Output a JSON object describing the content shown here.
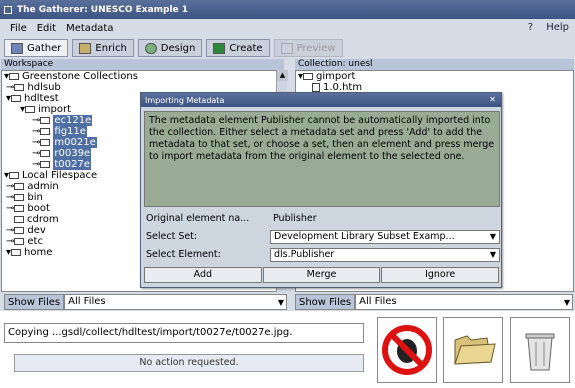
{
  "window": {
    "title": "The Gatherer: UNESCO Example 1"
  },
  "menu": {
    "file": "File",
    "edit": "Edit",
    "metadata": "Metadata",
    "help": "Help"
  },
  "tabs": [
    {
      "label": "Gather"
    },
    {
      "label": "Enrich"
    },
    {
      "label": "Design"
    },
    {
      "label": "Create"
    },
    {
      "label": "Preview"
    }
  ],
  "workspace": {
    "header": "Workspace",
    "items": [
      "Greenstone Collections",
      "hdlsub",
      "hdltest",
      "import",
      "ec121e",
      "fig11e",
      "m0021e",
      "r0039e",
      "t0027e",
      "Local Filespace",
      "admin",
      "bin",
      "boot",
      "cdrom",
      "dev",
      "etc",
      "home"
    ]
  },
  "collection": {
    "header": "Collection: unesl",
    "items": [
      "gimport",
      "1.0.htm"
    ]
  },
  "filters": {
    "label": "Show Files",
    "value": "All Files"
  },
  "dialog": {
    "title": "Importing Metadata",
    "message": "The metadata element Publisher cannot be automatically imported into the collection. Either select a metadata set and press 'Add' to add the metadata to that set, or choose a set, then an element and press merge to import metadata from the original element to the selected one.",
    "original_label": "Original element na...",
    "original_value": "Publisher",
    "set_label": "Select Set:",
    "set_value": "Development Library Subset Examp...",
    "element_label": "Select Element:",
    "element_value": "dls.Publisher",
    "add": "Add",
    "merge": "Merge",
    "ignore": "Ignore"
  },
  "status": {
    "copying": "Copying ...gsdl/collect/hdltest/import/t0027e/t0027e.jpg.",
    "action": "No action requested."
  },
  "icons": [
    "stop-icon",
    "folder-icon",
    "trash-icon"
  ],
  "colors": {
    "title_bar": "#4a5f8e",
    "message_bg": "#9aab95",
    "highlight": "#4f6fa5"
  }
}
